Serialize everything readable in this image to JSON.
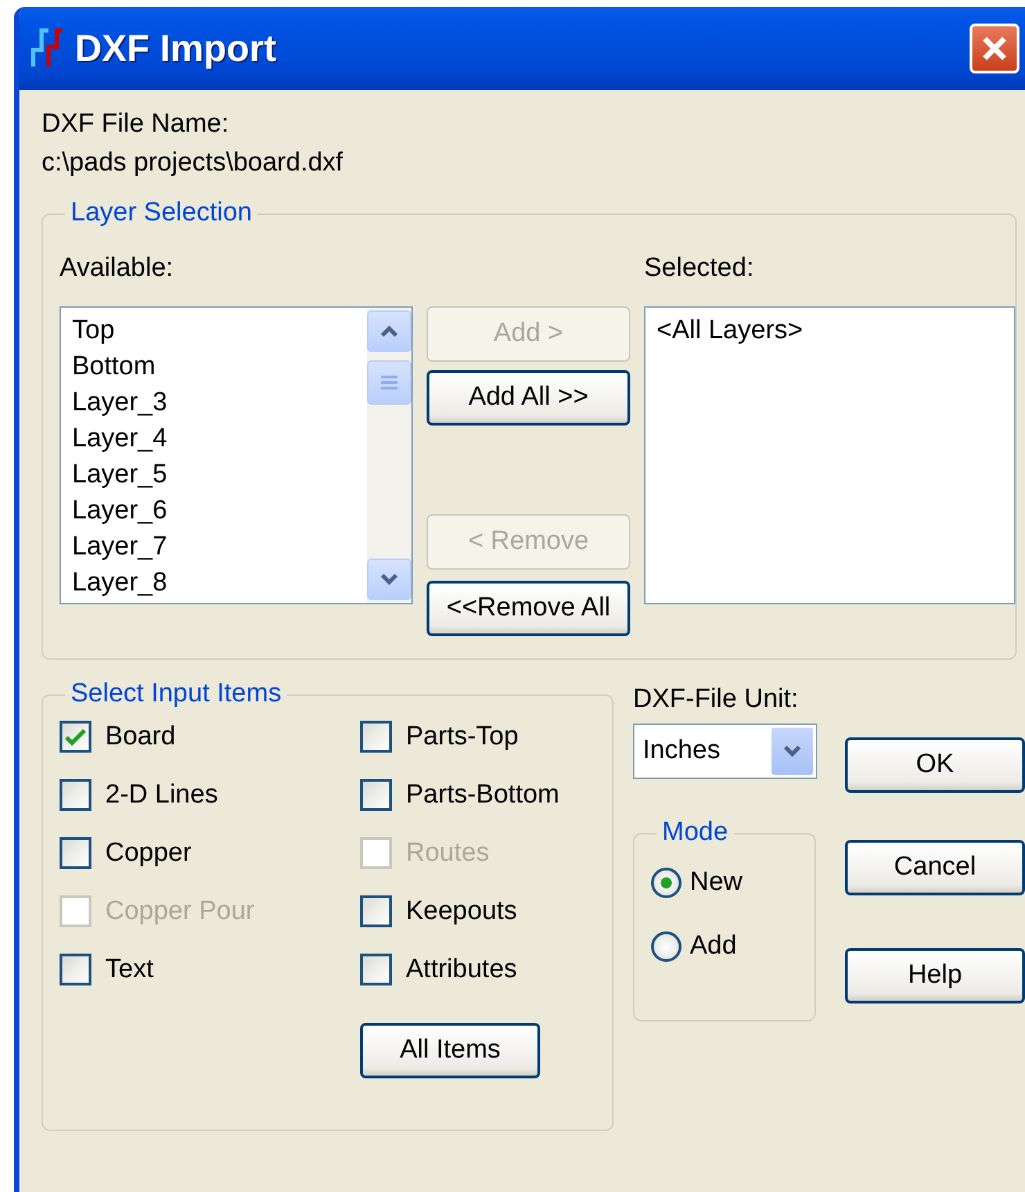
{
  "window": {
    "title": "DXF Import"
  },
  "file": {
    "label": "DXF File Name:",
    "path": "c:\\pads projects\\board.dxf"
  },
  "layer_selection": {
    "title": "Layer Selection",
    "available_label": "Available:",
    "selected_label": "Selected:",
    "available": [
      "Top",
      "Bottom",
      "Layer_3",
      "Layer_4",
      "Layer_5",
      "Layer_6",
      "Layer_7",
      "Layer_8"
    ],
    "selected": [
      "<All Layers>"
    ],
    "buttons": [
      {
        "label": "Add >",
        "disabled": true
      },
      {
        "label": "Add All >>",
        "disabled": false
      },
      {
        "label": "< Remove",
        "disabled": true
      },
      {
        "label": "<<Remove All",
        "disabled": false
      }
    ]
  },
  "input_items": {
    "title": "Select Input Items",
    "items": [
      {
        "label": "Board",
        "checked": true,
        "disabled": false
      },
      {
        "label": "Parts-Top",
        "checked": false,
        "disabled": false
      },
      {
        "label": "2-D Lines",
        "checked": false,
        "disabled": false
      },
      {
        "label": "Parts-Bottom",
        "checked": false,
        "disabled": false
      },
      {
        "label": "Copper",
        "checked": false,
        "disabled": false
      },
      {
        "label": "Routes",
        "checked": false,
        "disabled": true
      },
      {
        "label": "Copper Pour",
        "checked": false,
        "disabled": true
      },
      {
        "label": "Keepouts",
        "checked": false,
        "disabled": false
      },
      {
        "label": "Text",
        "checked": false,
        "disabled": false
      },
      {
        "label": "Attributes",
        "checked": false,
        "disabled": false
      }
    ],
    "button": "All  Items"
  },
  "unit": {
    "label": "DXF-File Unit:",
    "value": "Inches"
  },
  "mode": {
    "title": "Mode",
    "options": [
      {
        "label": "New",
        "selected": true
      },
      {
        "label": "Add",
        "selected": false
      }
    ]
  },
  "buttons": [
    "OK",
    "Cancel",
    "Help"
  ]
}
